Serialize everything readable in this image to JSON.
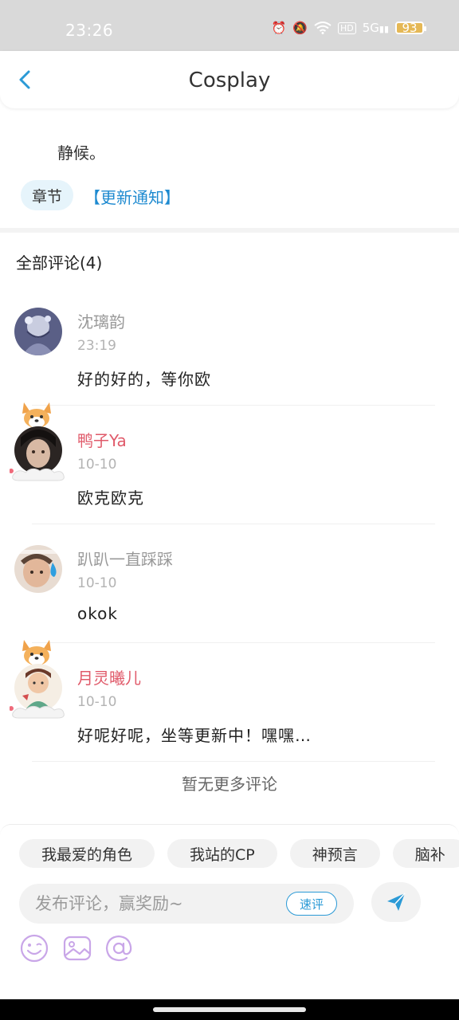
{
  "status_bar": {
    "time": "23:26",
    "battery": "93",
    "network": "5G",
    "hd": "HD"
  },
  "nav": {
    "title": "Cosplay"
  },
  "chapter": {
    "intro_text": "静候。",
    "chip_label": "章节",
    "update_link": "【更新通知】"
  },
  "comments": {
    "header": "全部评论(4)",
    "items": [
      {
        "name": "沈璃韵",
        "time": "23:19",
        "text": "好的好的，等你欧",
        "vip": false
      },
      {
        "name": "鸭子Ya",
        "time": "10-10",
        "text": "欧克欧克",
        "vip": true
      },
      {
        "name": "趴趴一直踩踩",
        "time": "10-10",
        "text": "okok",
        "vip": false
      },
      {
        "name": "月灵曦儿",
        "time": "10-10",
        "text": "好呢好呢，坐等更新中！嘿嘿…",
        "vip": true
      }
    ],
    "no_more": "暂无更多评论"
  },
  "composer": {
    "quick_tags": [
      "我最爱的角色",
      "我站的CP",
      "神预言",
      "脑补"
    ],
    "placeholder": "发布评论，赢奖励~",
    "quick_review_label": "速评"
  },
  "colors": {
    "accent_blue": "#2b9ad6",
    "vip_name": "#e05a6a",
    "icon_purple": "#c9a6e8"
  }
}
